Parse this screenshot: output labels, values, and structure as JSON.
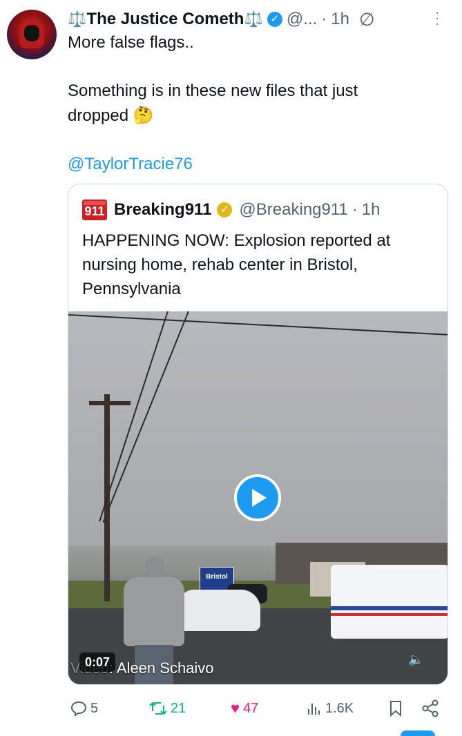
{
  "tweet": {
    "author_name": "The Justice Cometh",
    "scale_left": "⚖️",
    "scale_right": "⚖️",
    "verified_badge": "✓",
    "handle": "@...",
    "separator": "·",
    "time": "1h",
    "grok_icon": "∅",
    "more_icon": "⋮",
    "line1": "More false flags..",
    "line2": "Something is in these new files that just",
    "line3": "dropped",
    "emoji": "🤔",
    "mention": "@TaylorTracie76"
  },
  "quote": {
    "logo_text": "911",
    "author_name": "Breaking911",
    "verified_badge": "✓",
    "handle": "@Breaking911",
    "separator": "·",
    "time": "1h",
    "text": "HAPPENING NOW: Explosion reported at nursing home, rehab center in Bristol, Pennsylvania",
    "video": {
      "sign_text": "Bristol",
      "duration": "0:07",
      "credit_covered": "Video",
      "credit": ": Aleen Schaivo",
      "speaker_icon": "🔈"
    }
  },
  "actions": {
    "reply_icon": "💬",
    "reply_count": "5",
    "repost_icon": "⟲",
    "repost_count": "21",
    "like_icon": "♥",
    "like_count": "47",
    "views_icon": "📊",
    "views_count": "1.6K",
    "bookmark_icon": "🔖",
    "share_icon": "share"
  },
  "colors": {
    "accent": "#1d9bf0",
    "repost": "#00ba7c",
    "like": "#f91880",
    "gold_badge": "#e2b719",
    "breaking_red": "#d31d25"
  }
}
